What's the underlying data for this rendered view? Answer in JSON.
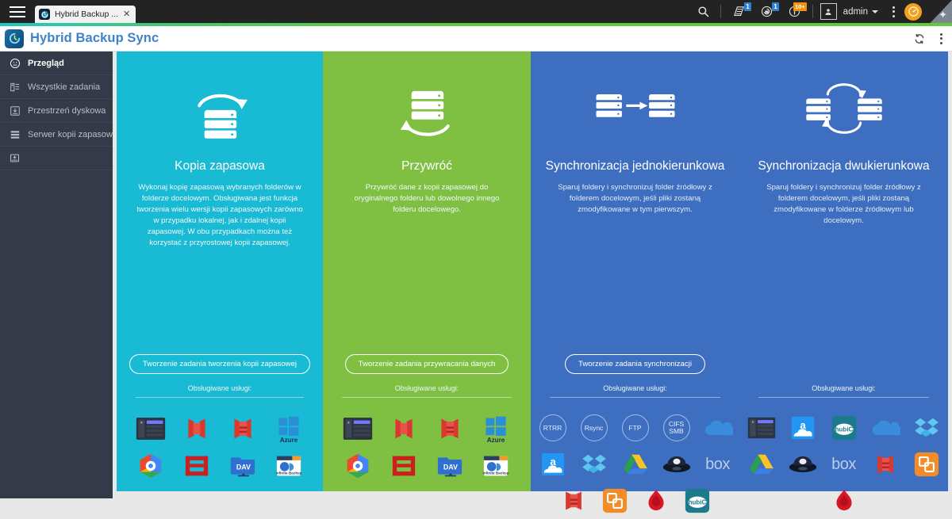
{
  "os": {
    "tab_title": "Hybrid Backup ...",
    "tab_close": "✕",
    "user": "admin",
    "badge_tasks": "1",
    "badge_alerts": "1",
    "badge_info": "10+"
  },
  "app": {
    "title": "Hybrid Backup Sync"
  },
  "sidebar": {
    "items": [
      {
        "label": "Przegląd",
        "icon": "overview-icon",
        "active": true
      },
      {
        "label": "Wszystkie zadania",
        "icon": "all-tasks-icon",
        "active": false
      },
      {
        "label": "Przestrzeń dyskowa",
        "icon": "disk-space-icon",
        "active": false,
        "chevron": true
      },
      {
        "label": "Serwer kopii zapasowej",
        "icon": "backup-server-icon",
        "active": false
      },
      {
        "label": "",
        "icon": "nas-backup-icon",
        "active": false
      }
    ]
  },
  "cards": [
    {
      "id": "backup",
      "title": "Kopia zapasowa",
      "desc": "Wykonaj kopię zapasową wybranych folderów w folderze docelowym. Obsługiwana jest funkcja tworzenia wielu wersji kopii zapasowych zarówno w przypadku lokalnej, jak i zdalnej kopii zapasowej. W obu przypadkach można też korzystać z przyrostowej kopii zapasowej.",
      "cta": "Tworzenie zadania tworzenia kopii zapasowej",
      "services_label": "Obsługiwane usługi:",
      "accent": "#19bad4",
      "services": [
        "qnap-nas-icon",
        "amazon-s3-icon",
        "amazon-glacier-icon",
        "azure-icon",
        "google-cloud-icon",
        "openstack-swift-icon",
        "webdav-icon",
        "infinite-backup-icon"
      ]
    },
    {
      "id": "restore",
      "title": "Przywróć",
      "desc": "Przywróć dane z kopii zapasowej do oryginalnego folderu lub dowolnego innego folderu docelowego.",
      "cta": "Tworzenie zadania przywracania danych",
      "services_label": "Obsługiwane usługi:",
      "accent": "#7fc043",
      "services": [
        "qnap-nas-icon",
        "amazon-s3-icon",
        "amazon-glacier-icon",
        "azure-icon",
        "google-cloud-icon",
        "openstack-swift-icon",
        "webdav-icon",
        "infinite-backup-icon"
      ]
    },
    {
      "id": "one-way-sync",
      "title": "Synchronizacja jednokierunkowa",
      "desc": "Sparuj foldery i synchronizuj folder źródłowy z folderem docelowym, jeśli pliki zostaną zmodyfikowane w tym pierwszym.",
      "cta": "Tworzenie zadania synchronizacji",
      "services_label": "Obsługiwane usługi:",
      "accent": "#3d6ec0",
      "protocols": [
        "RTRR",
        "Rsync",
        "FTP",
        "CIFS\nSMB"
      ],
      "services": [
        "onedrive-icon",
        "amazon-drive-icon",
        "dropbox-icon",
        "google-drive-icon",
        "yandex-disk-icon",
        "box-icon",
        "amazon-glacier-icon",
        "openstack-swift-icon",
        "hidrive-icon",
        "hubic-icon"
      ]
    },
    {
      "id": "two-way-sync",
      "title": "Synchronizacja dwukierunkowa",
      "desc": "Sparuj foldery i synchronizuj folder źródłowy z folderem docelowym, jeśli pliki zostaną zmodyfikowane w folderze źródłowym lub docelowym.",
      "cta": "",
      "services_label": "Obsługiwane usługi:",
      "accent": "#3d6ec0",
      "services": [
        "qnap-nas-icon",
        "amazon-drive-icon",
        "hubic-icon",
        "onedrive-icon",
        "dropbox-icon",
        "google-drive-icon",
        "yandex-disk-icon",
        "box-icon",
        "amazon-glacier-icon",
        "openstack-swift-icon",
        "hidrive-icon"
      ]
    }
  ],
  "colors": {
    "card_backup": "#19bad4",
    "card_restore": "#7fc043",
    "card_sync": "#3d6ec0",
    "sidebar_bg": "#343a47",
    "app_title": "#3e82c8",
    "badge_blue": "#2f7fd0",
    "badge_orange": "#f0920a"
  }
}
